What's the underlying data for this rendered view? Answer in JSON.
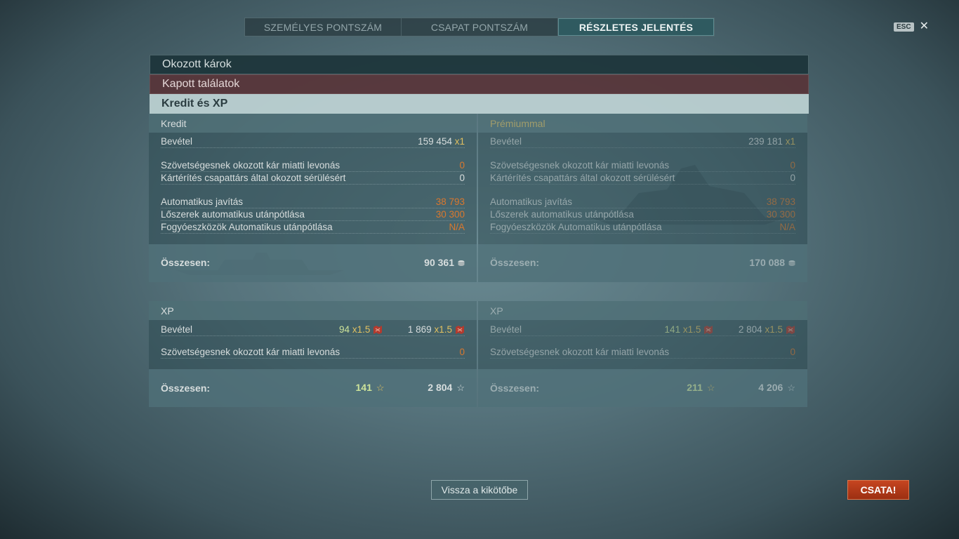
{
  "tabs": [
    {
      "label": "SZEMÉLYES PONTSZÁM",
      "active": false
    },
    {
      "label": "CSAPAT PONTSZÁM",
      "active": false
    },
    {
      "label": "RÉSZLETES JELENTÉS",
      "active": true
    }
  ],
  "esc": {
    "label": "ESC",
    "close_glyph": "✕"
  },
  "sections": {
    "damage": "Okozott károk",
    "hits": "Kapott találatok",
    "credit_xp": "Kredit és XP"
  },
  "credit": {
    "heading": "Kredit",
    "income_label": "Bevétel",
    "income_value": "159 454",
    "income_mult": "x1",
    "ally_damage_label": "Szövetségesnek okozott kár miatti levonás",
    "ally_damage_value": "0",
    "compensation_label": "Kártérítés csapattárs által okozott sérülésért",
    "compensation_value": "0",
    "repair_label": "Automatikus javítás",
    "repair_value": "38 793",
    "ammo_label": "Lőszerek automatikus utánpótlása",
    "ammo_value": "30 300",
    "consumables_label": "Fogyóeszközök Automatikus utánpótlása",
    "consumables_value": "N/A",
    "total_label": "Összesen:",
    "total_value": "90 361"
  },
  "premium": {
    "heading": "Prémiummal",
    "income_label": "Bevétel",
    "income_value": "239 181",
    "income_mult": "x1",
    "ally_damage_label": "Szövetségesnek okozott kár miatti levonás",
    "ally_damage_value": "0",
    "compensation_label": "Kártérítés csapattárs által okozott sérülésért",
    "compensation_value": "0",
    "repair_label": "Automatikus javítás",
    "repair_value": "38 793",
    "ammo_label": "Lőszerek automatikus utánpótlása",
    "ammo_value": "30 300",
    "consumables_label": "Fogyóeszközök Automatikus utánpótlása",
    "consumables_value": "N/A",
    "total_label": "Összesen:",
    "total_value": "170 088"
  },
  "xp": {
    "heading": "XP",
    "income_label": "Bevétel",
    "income_value1": "94",
    "income_mult1": "x1.5",
    "income_value2": "1 869",
    "income_mult2": "x1.5",
    "ally_damage_label": "Szövetségesnek okozott kár miatti levonás",
    "ally_damage_value": "0",
    "total_label": "Összesen:",
    "total_value1": "141",
    "total_value2": "2 804"
  },
  "xp_premium": {
    "heading": "XP",
    "income_label": "Bevétel",
    "income_value1": "141",
    "income_mult1": "x1.5",
    "income_value2": "2 804",
    "income_mult2": "x1.5",
    "ally_damage_label": "Szövetségesnek okozott kár miatti levonás",
    "ally_damage_value": "0",
    "total_label": "Összesen:",
    "total_value1": "211",
    "total_value2": "4 206"
  },
  "buttons": {
    "back": "Vissza a kikötőbe",
    "battle": "CSATA!"
  },
  "icons": {
    "credit": "credit-coin-icon",
    "xp_star": "☆",
    "flag": "signal-flag-icon"
  },
  "colors": {
    "accent_orange": "#d9782e",
    "xp_green": "#cde39a",
    "battle_red": "#b23a18"
  }
}
